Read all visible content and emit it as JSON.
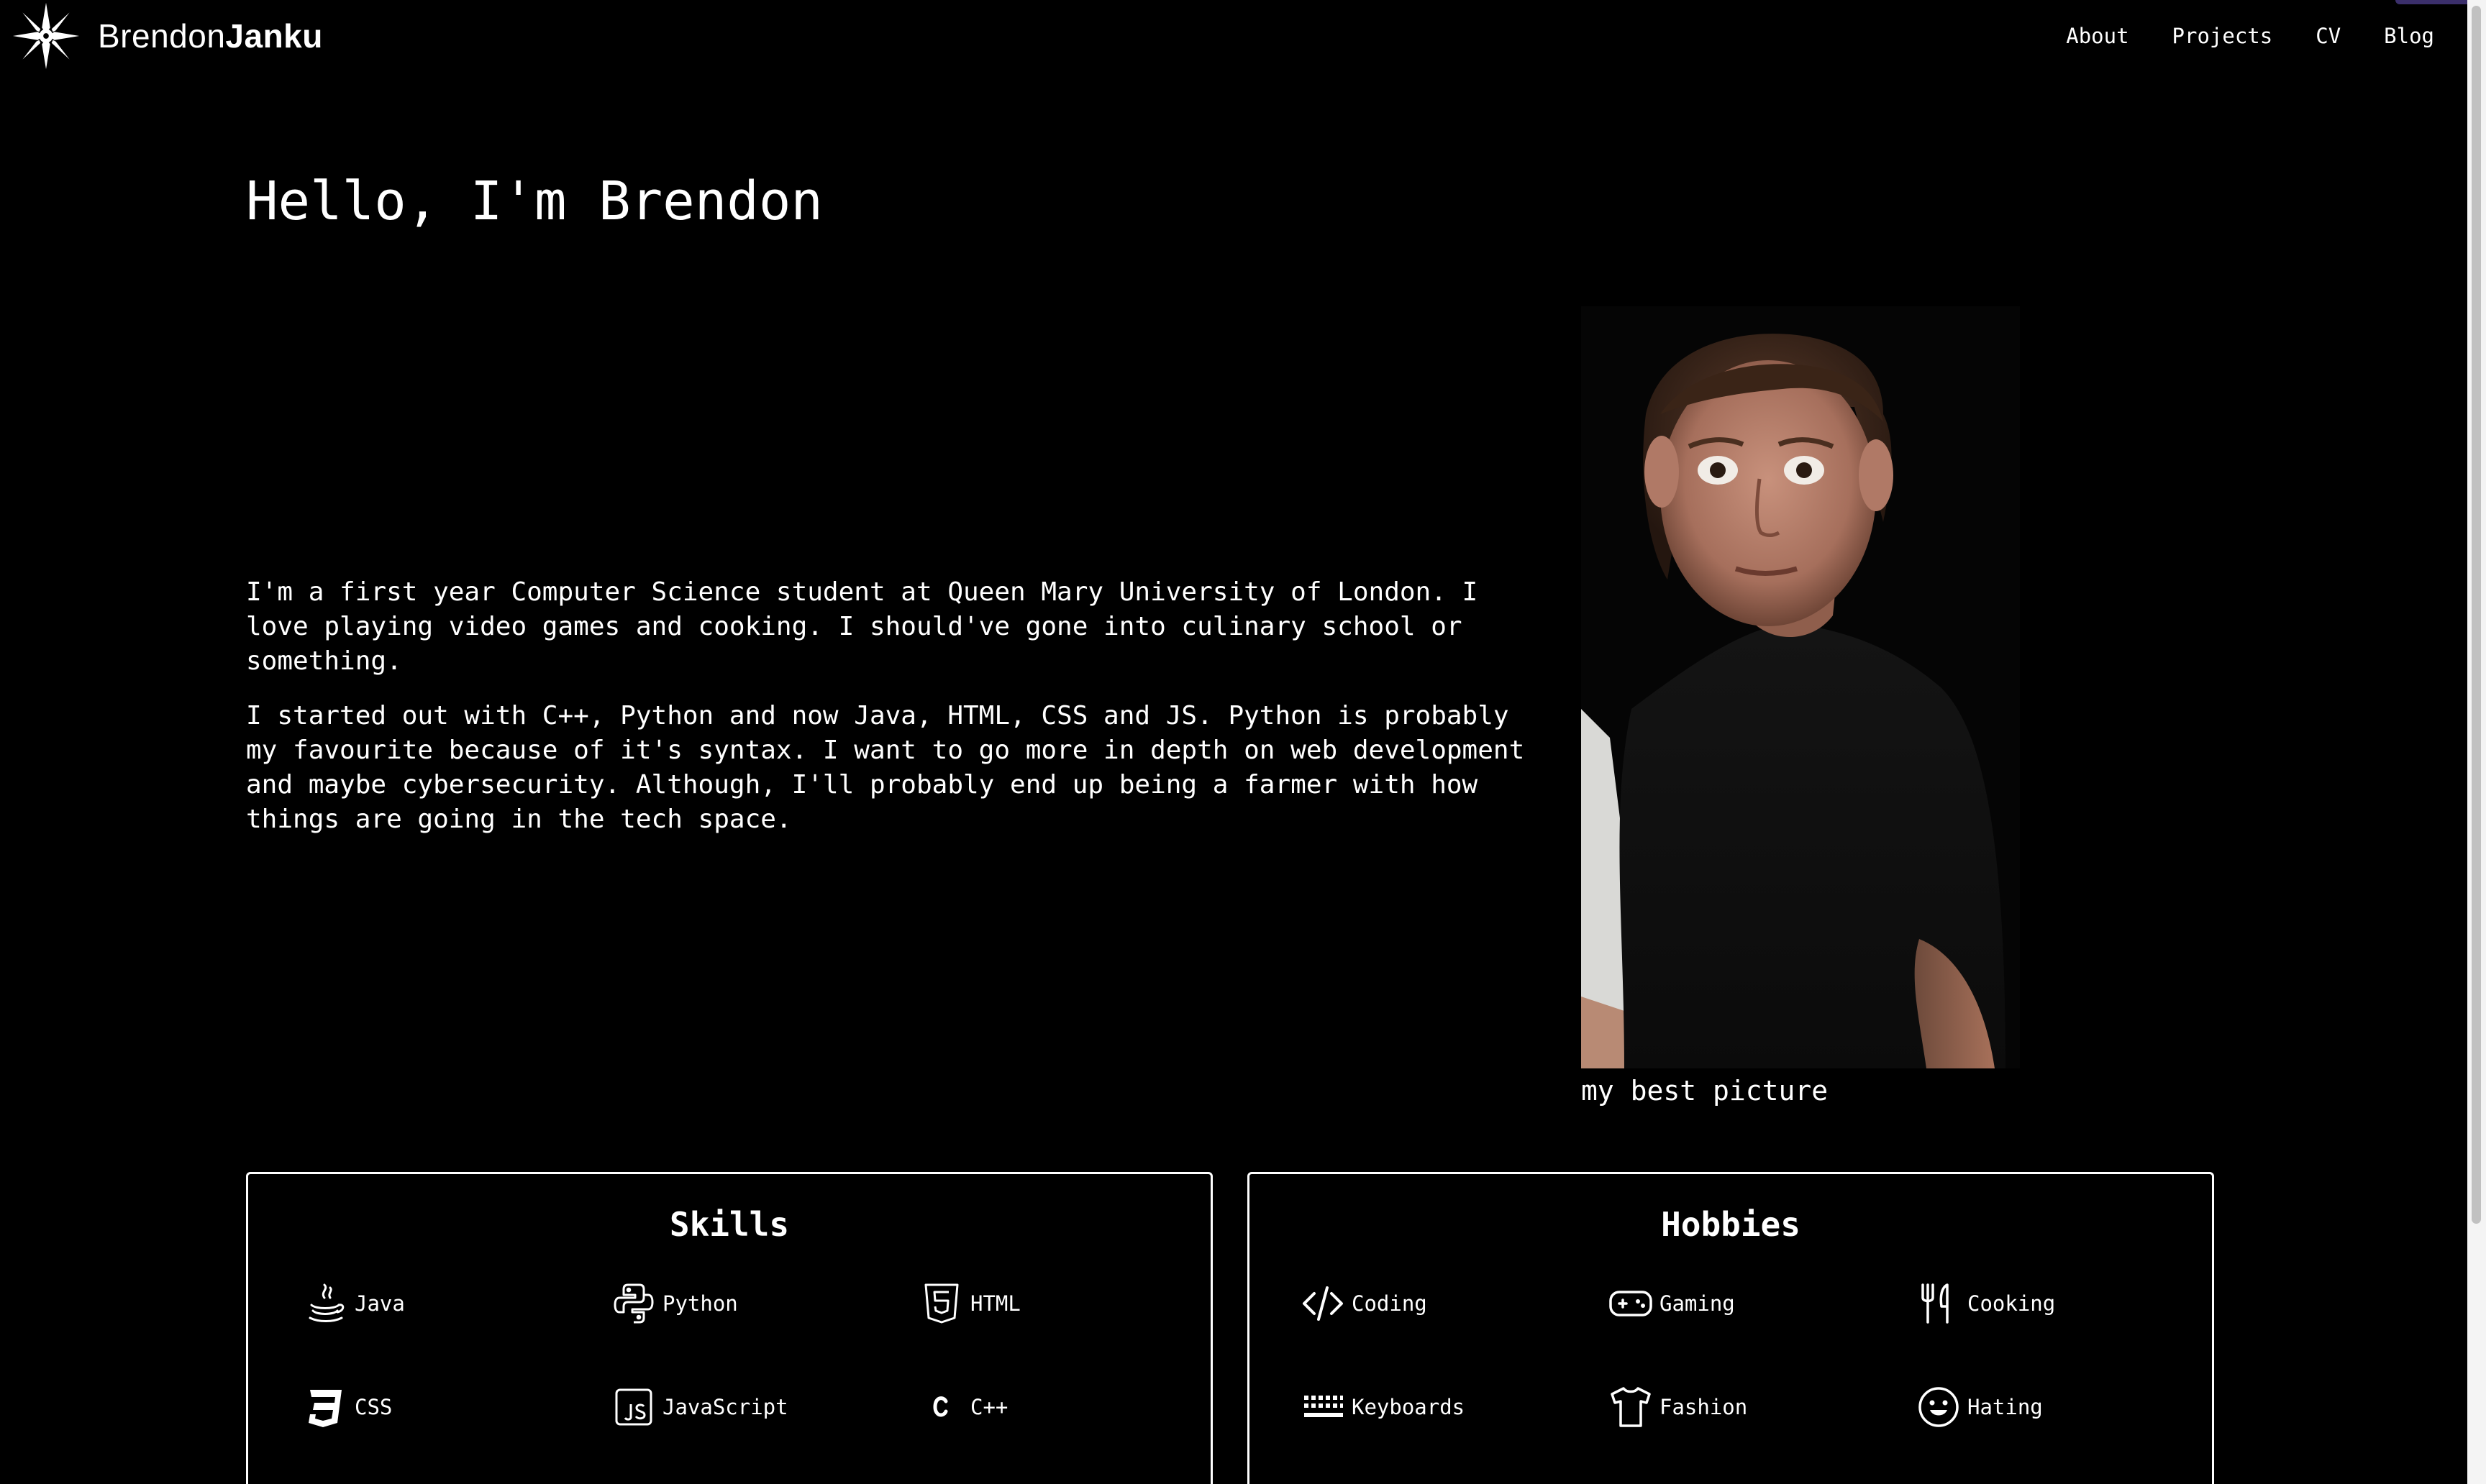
{
  "nav": {
    "brand_light": "Brendon",
    "brand_bold": "Janku",
    "links": [
      "About",
      "Projects",
      "CV",
      "Blog"
    ]
  },
  "hero": {
    "greeting": "Hello, I'm Brendon",
    "paragraphs": [
      "I'm a first year Computer Science student at Queen Mary University of London. I love playing video games and cooking. I should've gone into culinary school or something.",
      "I started out with C++, Python and now Java, HTML, CSS and JS. Python is probably my favourite because of it's syntax. I want to go more in depth on web development and maybe cybersecurity. Although, I'll probably end up being a farmer with how things are going in the tech space."
    ],
    "photo_caption": "my best picture"
  },
  "skills": {
    "title": "Skills",
    "items": [
      {
        "label": "Java",
        "icon": "java-icon"
      },
      {
        "label": "Python",
        "icon": "python-icon"
      },
      {
        "label": "HTML",
        "icon": "html5-icon"
      },
      {
        "label": "CSS",
        "icon": "css3-icon"
      },
      {
        "label": "JavaScript",
        "icon": "javascript-icon"
      },
      {
        "label": "C++",
        "icon": "c-icon"
      }
    ]
  },
  "hobbies": {
    "title": "Hobbies",
    "items": [
      {
        "label": "Coding",
        "icon": "code-icon"
      },
      {
        "label": "Gaming",
        "icon": "gamepad-icon"
      },
      {
        "label": "Cooking",
        "icon": "fork-knife-icon"
      },
      {
        "label": "Keyboards",
        "icon": "keyboard-icon"
      },
      {
        "label": "Fashion",
        "icon": "shirt-icon"
      },
      {
        "label": "Hating",
        "icon": "smiley-icon"
      }
    ]
  },
  "colors": {
    "background": "#000000",
    "text": "#ffffff",
    "border": "#ffffff"
  }
}
